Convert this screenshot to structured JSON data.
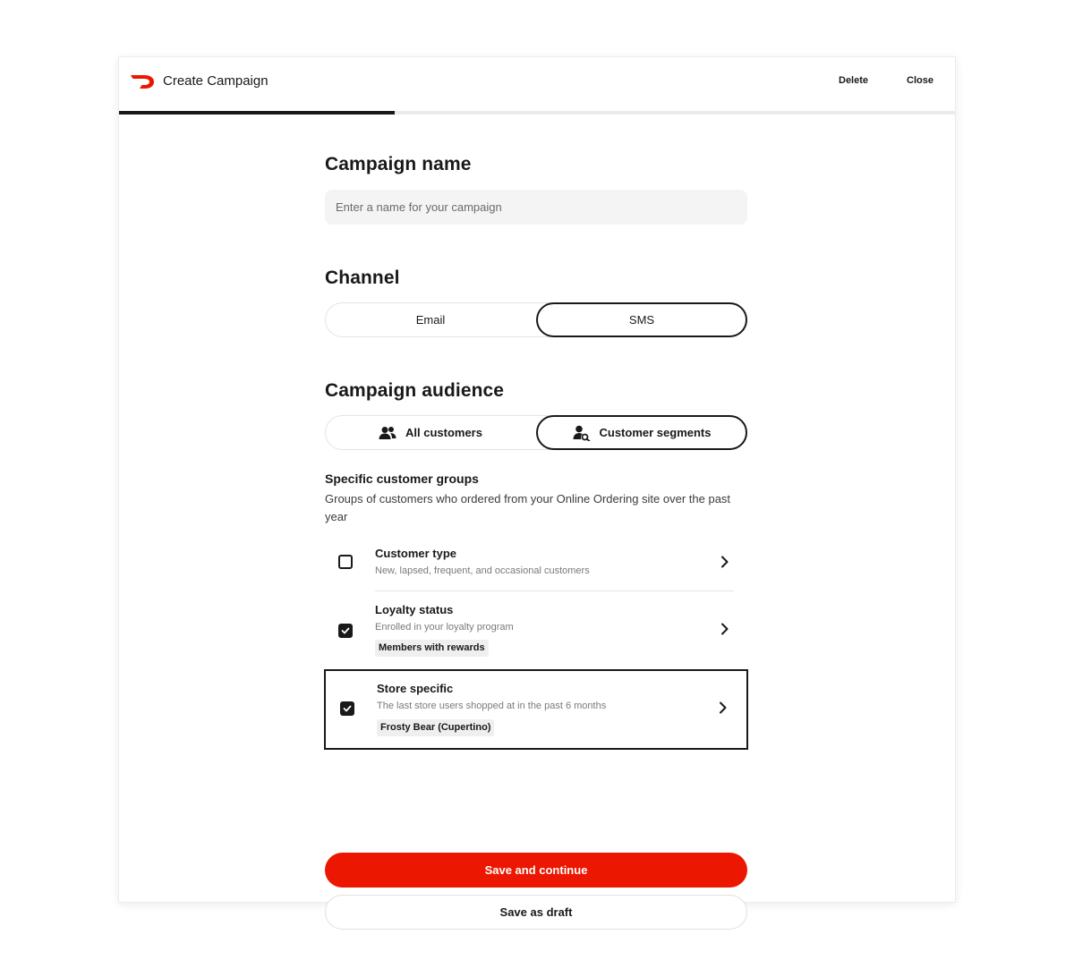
{
  "header": {
    "title": "Create Campaign",
    "delete_label": "Delete",
    "close_label": "Close",
    "progress_fraction": 0.33
  },
  "campaign_name": {
    "heading": "Campaign name",
    "placeholder": "Enter a name for your campaign",
    "value": ""
  },
  "channel": {
    "heading": "Channel",
    "options": [
      {
        "label": "Email",
        "selected": false
      },
      {
        "label": "SMS",
        "selected": true
      }
    ]
  },
  "audience": {
    "heading": "Campaign audience",
    "options": [
      {
        "label": "All customers",
        "icon": "users-icon",
        "selected": false
      },
      {
        "label": "Customer segments",
        "icon": "user-search-icon",
        "selected": true
      }
    ]
  },
  "groups": {
    "title": "Specific customer groups",
    "description": "Groups of customers who ordered from your Online Ordering site over the past year",
    "items": [
      {
        "title": "Customer type",
        "subtitle": "New, lapsed, frequent, and occasional customers",
        "checked": false,
        "tag": ""
      },
      {
        "title": "Loyalty status",
        "subtitle": "Enrolled in your loyalty program",
        "checked": true,
        "tag": "Members with rewards"
      },
      {
        "title": "Store specific",
        "subtitle": "The last store users shopped at in the past 6 months",
        "checked": true,
        "tag": "Frosty Bear (Cupertino)"
      }
    ]
  },
  "actions": {
    "primary_label": "Save and continue",
    "secondary_label": "Save as draft"
  },
  "colors": {
    "brand": "#eb1700",
    "text": "#191919"
  }
}
